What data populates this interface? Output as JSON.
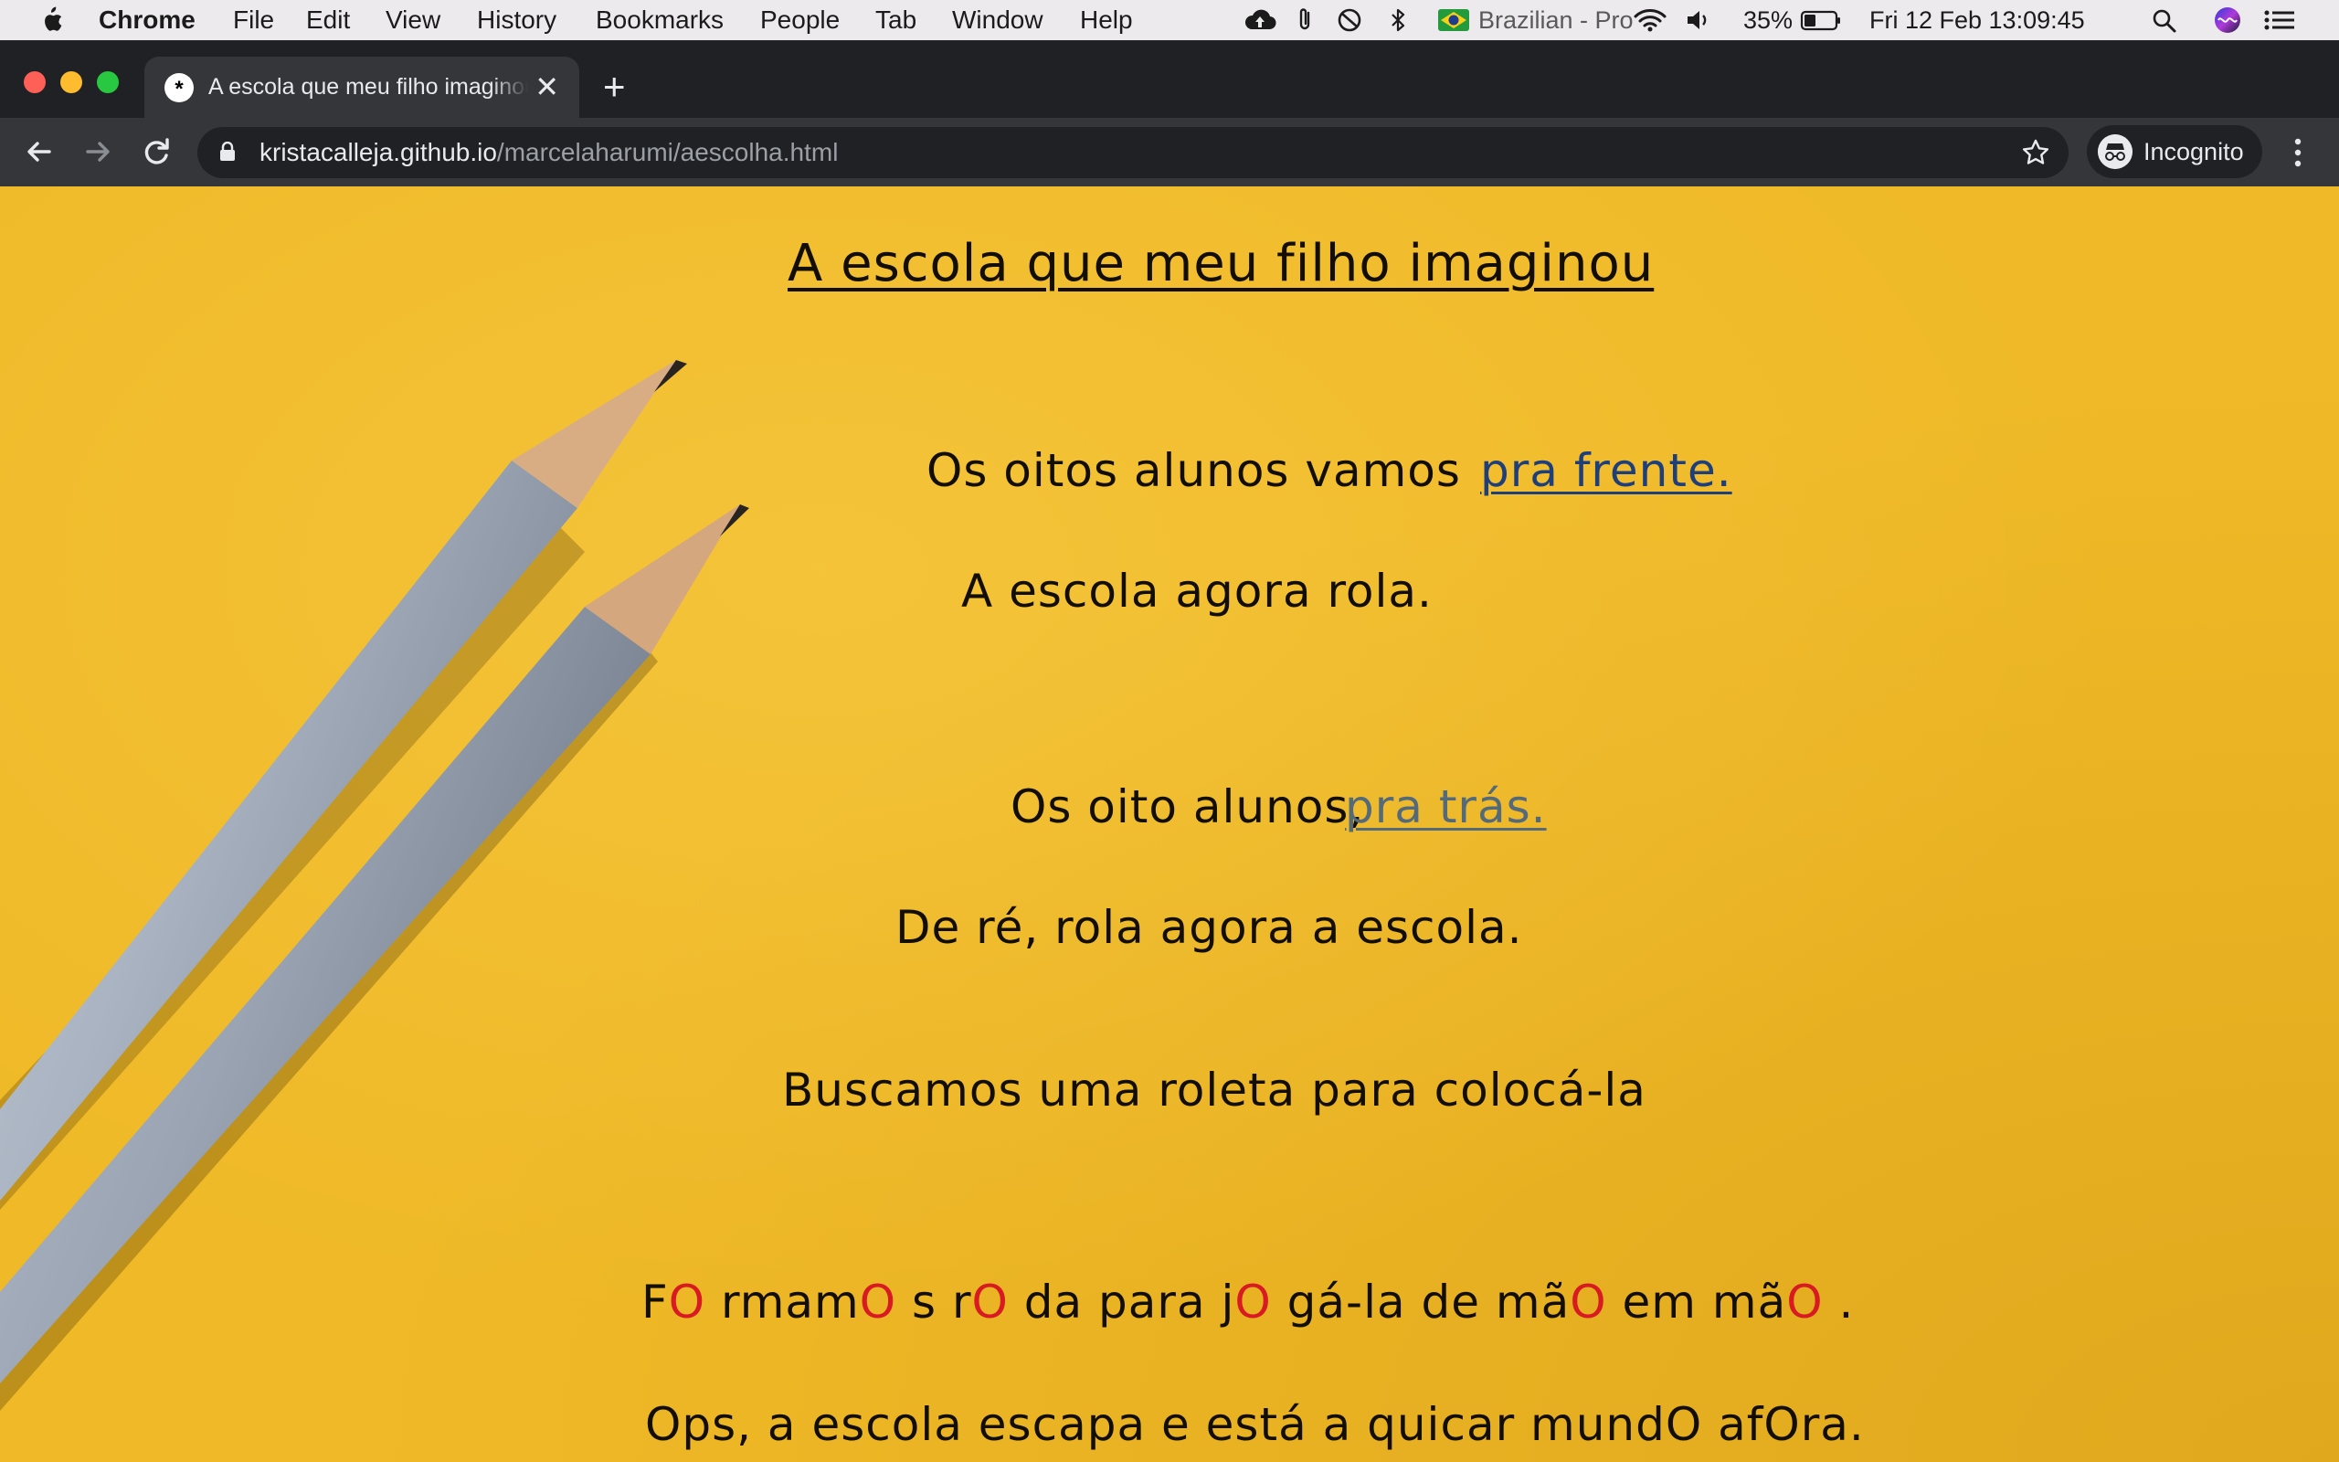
{
  "menubar": {
    "app_name": "Chrome",
    "items": [
      "File",
      "Edit",
      "View",
      "History",
      "Bookmarks",
      "People",
      "Tab",
      "Window",
      "Help"
    ],
    "input_source": "Brazilian - Pro",
    "battery": "35%",
    "datetime": "Fri 12 Feb  13:09:45",
    "icons": [
      "apple-icon",
      "cloud-upload-icon",
      "paperclip-icon",
      "do-not-disturb-icon",
      "bluetooth-icon",
      "brazil-flag-icon",
      "wifi-icon",
      "volume-icon",
      "battery-icon",
      "spotlight-search-icon",
      "siri-icon",
      "control-center-icon"
    ]
  },
  "browser": {
    "tab_title": "A escola que meu filho imaginou",
    "url_host": "kristacalleja.github.io",
    "url_path": "/marcelaharumi/aescolha.html",
    "profile_label": "Incognito"
  },
  "page": {
    "title": "A escola que meu filho imaginou",
    "lines": {
      "l1_text": "Os oitos alunos vamos",
      "l1_link": "pra frente.",
      "l2": "A escola agora rola.",
      "l3_text": "Os oito alunos,",
      "l3_link": "pra trás.",
      "l4": "De ré, rola agora a escola.",
      "l5": "Buscamos uma roleta para colocá-la",
      "l6_parts": [
        "F",
        "O",
        " rmam",
        "O",
        " s r",
        "O",
        " da para j",
        "O",
        " gá-la de mã",
        "O",
        " em mã",
        "O",
        " ."
      ],
      "l7": "Ops, a escola escapa e está a quicar mundO afOra."
    }
  },
  "colors": {
    "page_background": "#efb927",
    "link_forward": "#1f3f7a",
    "link_back": "#556a78",
    "highlight_o": "#d81a22"
  }
}
